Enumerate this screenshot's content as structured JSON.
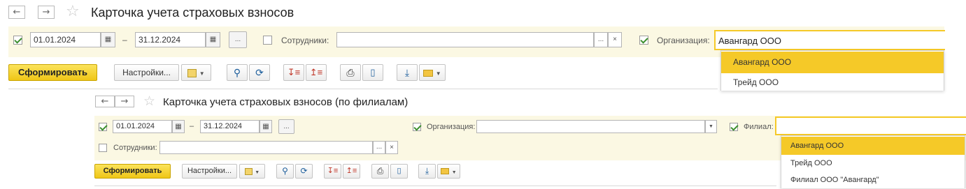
{
  "window1": {
    "title": "Карточка учета страховых взносов",
    "nav_back": "←",
    "nav_forward": "→",
    "date_from": "01.01.2024",
    "date_sep": "–",
    "date_to": "31.12.2024",
    "period_btn": "...",
    "employees_label": "Сотрудники:",
    "employees_value": "",
    "org_label": "Организация:",
    "org_value": "Авангард ООО",
    "generate_label": "Сформировать",
    "settings_label": "Настройки...",
    "dropdown": [
      "Авангард ООО",
      "Трейд ООО"
    ]
  },
  "window2": {
    "title": "Карточка учета страховых взносов (по филиалам)",
    "nav_back": "←",
    "nav_forward": "→",
    "date_from": "01.01.2024",
    "date_sep": "–",
    "date_to": "31.12.2024",
    "period_btn": "...",
    "org_label": "Организация:",
    "org_value": "",
    "branch_label": "Филиал:",
    "branch_value": "",
    "employees_label": "Сотрудники:",
    "employees_value": "",
    "generate_label": "Сформировать",
    "settings_label": "Настройки...",
    "dropdown": [
      "Авангард ООО",
      "Трейд ООО",
      "Филиал ООО \"Авангард\""
    ]
  },
  "colors": {
    "accent": "#f5c928",
    "band": "#fbf8e3",
    "check": "#3c8f2e"
  }
}
